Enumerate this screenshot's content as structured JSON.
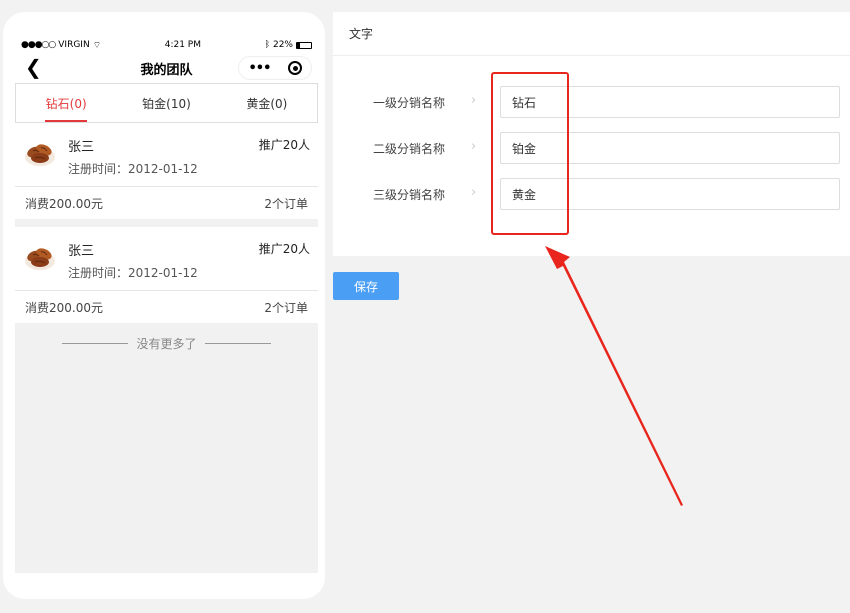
{
  "phone": {
    "statusbar": {
      "carrier": "VIRGIN",
      "time": "4:21 PM",
      "battery": "22%",
      "battery_level": 0.22
    },
    "navbar": {
      "title": "我的团队",
      "back_icon": "chevron-left-icon",
      "more_icon": "more-dots-icon",
      "target_icon": "record-icon"
    },
    "tabs": [
      {
        "label": "钻石(0)",
        "active": true
      },
      {
        "label": "铂金(10)",
        "active": false
      },
      {
        "label": "黄金(0)",
        "active": false
      }
    ],
    "members": [
      {
        "name": "张三",
        "registered": "注册时间：2012-01-12",
        "promotion": "推广20人",
        "spent": "消费200.00元",
        "orders": "2个订单"
      },
      {
        "name": "张三",
        "registered": "注册时间：2012-01-12",
        "promotion": "推广20人",
        "spent": "消费200.00元",
        "orders": "2个订单"
      }
    ],
    "no_more": "没有更多了"
  },
  "panel": {
    "header": "文字",
    "rows": [
      {
        "label": "一级分销名称",
        "value": "钻石"
      },
      {
        "label": "二级分销名称",
        "value": "铂金"
      },
      {
        "label": "三级分销名称",
        "value": "黄金"
      }
    ],
    "save_label": "保存"
  },
  "colors": {
    "accent_red": "#e4393c",
    "button_blue": "#4a9ff5",
    "annotation_red": "#e8261d"
  }
}
